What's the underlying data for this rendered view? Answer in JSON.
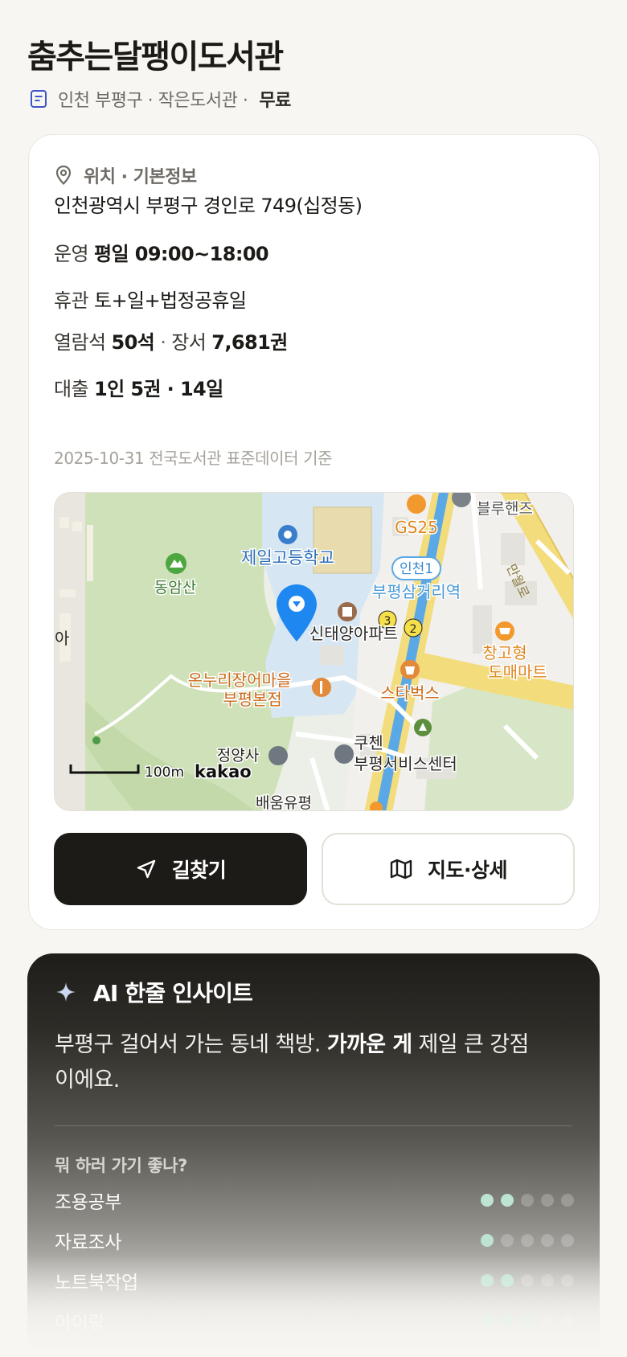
{
  "header": {
    "title": "춤추는달팽이도서관",
    "meta_text": "인천 부평구 · 작은도서관 ·",
    "fee": "무료"
  },
  "info": {
    "section_title": "위치 · 기본정보",
    "address": "인천광역시 부평구 경인로 749(십정동)",
    "hours_label": "운영",
    "hours_value": "평일 09:00~18:00",
    "closed_label": "휴관",
    "closed_value": "토+일+법정공휴일",
    "seats_label": "열람석",
    "seats_value": "50석",
    "sep": " · ",
    "books_label": "장서",
    "books_value": "7,681권",
    "loan_label": "대출",
    "loan_value": "1인 5권 · 14일",
    "source": "2025-10-31 전국도서관 표준데이터 기준"
  },
  "map": {
    "labels": {
      "school": "제일고등학교",
      "mountain": "동암산",
      "gs25": "GS25",
      "incheon1": "인천1",
      "station": "부평삼거리역",
      "apartment": "신태양아파트",
      "market": "온누리장어마을",
      "market2": "부평본점",
      "starbucks": "스타벅스",
      "wholesale": "창고형",
      "wholesale2": "도매마트",
      "temple": "정양사",
      "cuchen": "쿠첸",
      "cuchen2": "부평서비스센터",
      "bluehands": "블루핸즈",
      "road": "만월로",
      "left_partial": "아",
      "bottom_partial": "배움유평",
      "exit3": "3",
      "exit2": "2",
      "scale": "100m",
      "brand": "kakao"
    }
  },
  "actions": {
    "directions": "길찾기",
    "map_detail": "지도·상세"
  },
  "ai": {
    "title": "AI 한줄 인사이트",
    "text_before": "부평구 걸어서 가는 동네 책방. ",
    "text_bold": "가까운 게",
    "text_after": " 제일 큰 강점이에요.",
    "question": "뭐 하러 가기 좋나?",
    "activities": [
      {
        "label": "조용공부",
        "score": 2,
        "max": 5
      },
      {
        "label": "자료조사",
        "score": 1,
        "max": 5
      },
      {
        "label": "노트북작업",
        "score": 2,
        "max": 5
      },
      {
        "label": "아이랑",
        "score": 3,
        "max": 5
      }
    ]
  },
  "colors": {
    "accent_dark": "#1d1b17",
    "pin_blue": "#1f87f0",
    "dot_active": "#bde3d3"
  }
}
